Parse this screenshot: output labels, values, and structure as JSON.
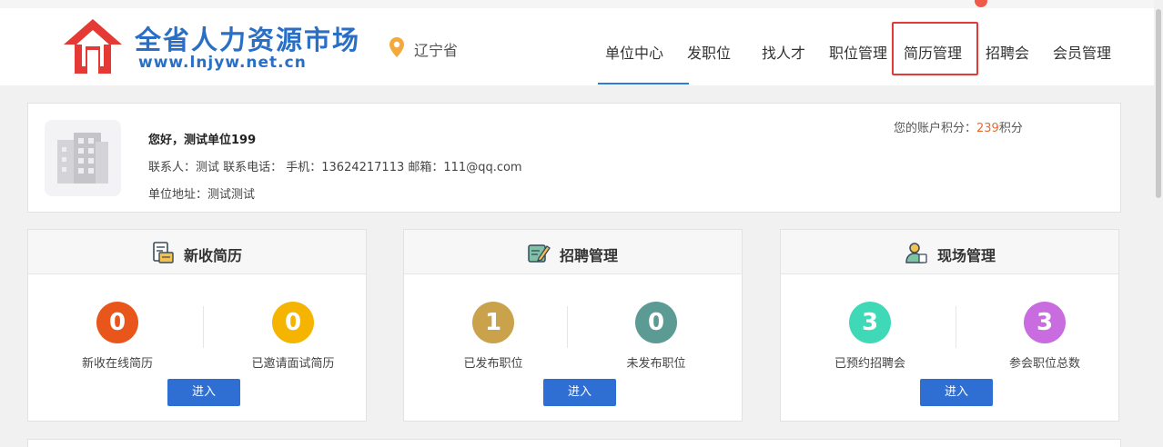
{
  "brand": {
    "title": "全省人力资源市场",
    "url": "www.lnjyw.net.cn"
  },
  "location": "辽宁省",
  "nav": {
    "items": [
      "单位中心",
      "发职位",
      "找人才",
      "职位管理",
      "简历管理",
      "招聘会",
      "会员管理"
    ],
    "active": "单位中心",
    "highlighted": "简历管理"
  },
  "profile": {
    "greeting": "您好，测试单位199",
    "contact_line": "联系人：测试  联系电话：  手机：13624217113  邮箱：111@qq.com",
    "address_line": "单位地址：测试测试",
    "points_prefix": "您的账户积分：",
    "points_value": "239",
    "points_suffix": "积分"
  },
  "panels": [
    {
      "title": "新收简历",
      "icon": "resume-inbox-icon",
      "stats": [
        {
          "value": "0",
          "label": "新收在线简历",
          "color": "#e8561b"
        },
        {
          "value": "0",
          "label": "已邀请面试简历",
          "color": "#f5b400"
        }
      ],
      "button": "进入"
    },
    {
      "title": "招聘管理",
      "icon": "recruit-edit-icon",
      "stats": [
        {
          "value": "1",
          "label": "已发布职位",
          "color": "#c9a24b"
        },
        {
          "value": "0",
          "label": "未发布职位",
          "color": "#5b9b94"
        }
      ],
      "button": "进入"
    },
    {
      "title": "现场管理",
      "icon": "onsite-person-icon",
      "stats": [
        {
          "value": "3",
          "label": "已预约招聘会",
          "color": "#3fd9b8"
        },
        {
          "value": "3",
          "label": "参会职位总数",
          "color": "#c96ce0"
        }
      ],
      "button": "进入"
    }
  ],
  "colors": {
    "brand_blue": "#2a6fc6",
    "button_blue": "#2f6fd3",
    "accent_orange": "#ef6a2a",
    "highlight_red": "#e53935"
  }
}
